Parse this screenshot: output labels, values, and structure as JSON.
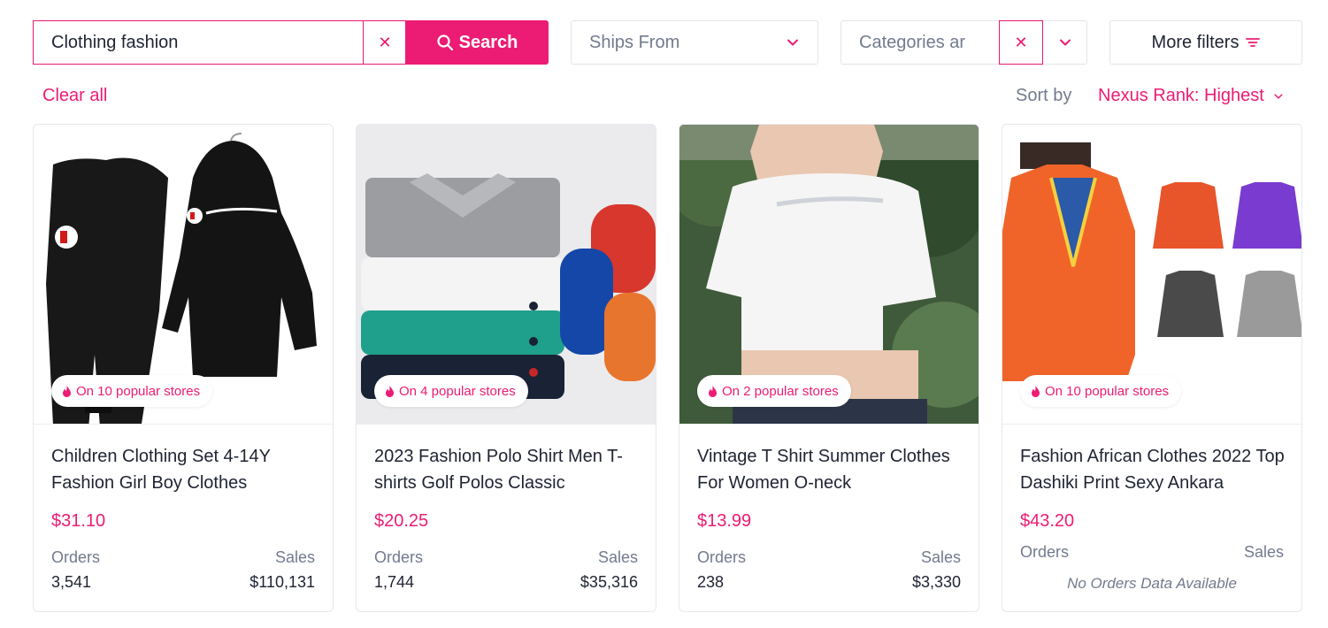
{
  "search": {
    "value": "Clothing fashion",
    "clear_icon": "close-icon",
    "button_label": "Search"
  },
  "filters": {
    "ships_from": {
      "label": "Ships From"
    },
    "categories": {
      "label": "Categories ar"
    },
    "more_filters": {
      "label": "More filters"
    }
  },
  "toolbar": {
    "clear_all": "Clear all",
    "sort_by_label": "Sort by",
    "sort_value": "Nexus Rank: Highest"
  },
  "colors": {
    "accent": "#ec1c74",
    "muted": "#737a8e",
    "text": "#1f2333",
    "border": "#e7e9ee"
  },
  "products": [
    {
      "badge": "On 10 popular stores",
      "title": "Children Clothing Set 4-14Y Fashion Girl Boy Clothes",
      "price": "$31.10",
      "orders_label": "Orders",
      "sales_label": "Sales",
      "orders": "3,541",
      "sales": "$110,131"
    },
    {
      "badge": "On 4 popular stores",
      "title": "2023 Fashion Polo Shirt Men T-shirts Golf Polos Classic",
      "price": "$20.25",
      "orders_label": "Orders",
      "sales_label": "Sales",
      "orders": "1,744",
      "sales": "$35,316"
    },
    {
      "badge": "On 2 popular stores",
      "title": "Vintage T Shirt Summer Clothes For Women O-neck",
      "price": "$13.99",
      "orders_label": "Orders",
      "sales_label": "Sales",
      "orders": "238",
      "sales": "$3,330"
    },
    {
      "badge": "On 10 popular stores",
      "title": "Fashion African Clothes 2022 Top Dashiki Print Sexy Ankara",
      "price": "$43.20",
      "orders_label": "Orders",
      "sales_label": "Sales",
      "no_data": "No Orders Data Available"
    }
  ]
}
